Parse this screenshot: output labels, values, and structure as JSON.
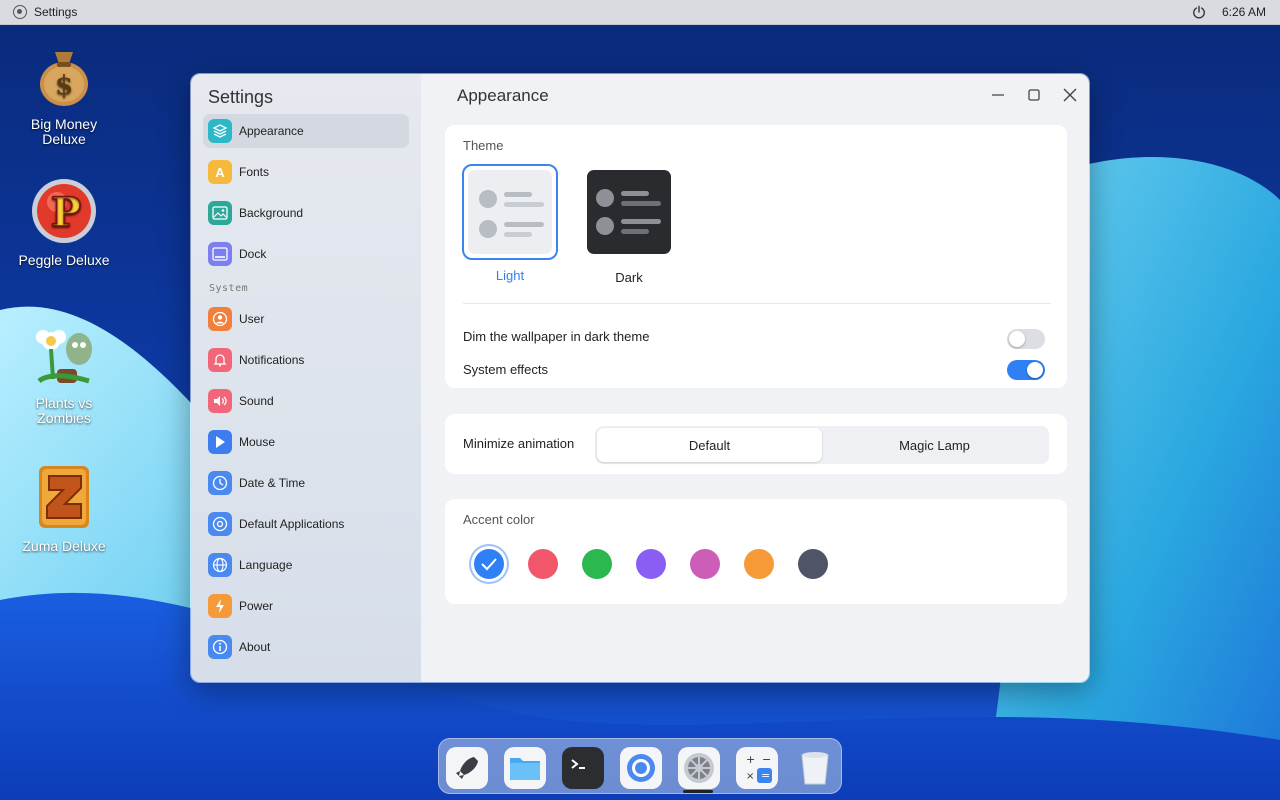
{
  "topbar": {
    "app_name": "Settings",
    "time": "6:26 AM"
  },
  "desktop": {
    "icons": [
      {
        "label_line1": "Big Money",
        "label_line2": "Deluxe",
        "icon": "money-bag-icon"
      },
      {
        "label_line1": "Peggle Deluxe",
        "label_line2": "",
        "icon": "peggle-icon"
      },
      {
        "label_line1": "Plants vs",
        "label_line2": "Zombies",
        "icon": "plants-vs-zombies-icon"
      },
      {
        "label_line1": "Zuma Deluxe",
        "label_line2": "",
        "icon": "zuma-icon"
      }
    ]
  },
  "window": {
    "sidebar": {
      "title": "Settings",
      "items": [
        {
          "label": "Appearance",
          "icon": "appearance-icon",
          "color": "#2bb8c9"
        },
        {
          "label": "Fonts",
          "icon": "fonts-icon",
          "color": "#f6b93b"
        },
        {
          "label": "Background",
          "icon": "background-icon",
          "color": "#2ba89a"
        },
        {
          "label": "Dock",
          "icon": "dock-icon",
          "color": "#7b7ff0"
        }
      ],
      "system_label": "System",
      "system_items": [
        {
          "label": "User",
          "icon": "user-icon",
          "color": "#f0803c"
        },
        {
          "label": "Notifications",
          "icon": "notifications-icon",
          "color": "#f2667a"
        },
        {
          "label": "Sound",
          "icon": "sound-icon",
          "color": "#f2667a"
        },
        {
          "label": "Mouse",
          "icon": "mouse-icon",
          "color": "#3c7ef0"
        },
        {
          "label": "Date & Time",
          "icon": "clock-icon",
          "color": "#4a8af0"
        },
        {
          "label": "Default Applications",
          "icon": "default-apps-icon",
          "color": "#4a8af0"
        },
        {
          "label": "Language",
          "icon": "globe-icon",
          "color": "#4a8af0"
        },
        {
          "label": "Power",
          "icon": "power-icon",
          "color": "#f59a3a"
        },
        {
          "label": "About",
          "icon": "info-icon",
          "color": "#4a8af0"
        }
      ]
    },
    "content": {
      "title": "Appearance",
      "theme": {
        "label": "Theme",
        "options": [
          {
            "label": "Light",
            "selected": true
          },
          {
            "label": "Dark",
            "selected": false
          }
        ]
      },
      "dim_wallpaper": {
        "label": "Dim the wallpaper in dark theme",
        "on": false
      },
      "system_effects": {
        "label": "System effects",
        "on": true
      },
      "minimize_animation": {
        "label": "Minimize animation",
        "options": [
          "Default",
          "Magic Lamp"
        ],
        "selected": "Default"
      },
      "accent": {
        "label": "Accent color",
        "colors": [
          "#2f7ff5",
          "#f2566a",
          "#2bb84f",
          "#8a5ef5",
          "#cc5eb8",
          "#f59a36",
          "#4f5566"
        ],
        "selected_index": 0
      }
    }
  },
  "dock": {
    "items": [
      {
        "name": "launcher-icon"
      },
      {
        "name": "files-icon"
      },
      {
        "name": "terminal-icon"
      },
      {
        "name": "browser-icon"
      },
      {
        "name": "settings-icon"
      },
      {
        "name": "calculator-icon"
      },
      {
        "name": "trash-icon"
      }
    ]
  }
}
